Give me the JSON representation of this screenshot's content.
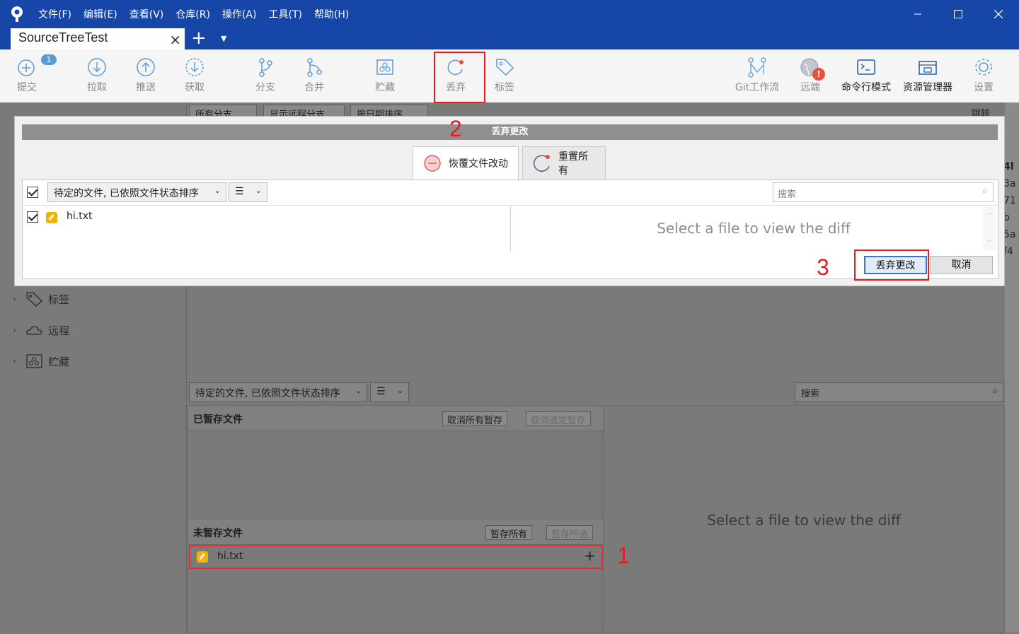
{
  "app": {
    "menu": [
      "文件(F)",
      "编辑(E)",
      "查看(V)",
      "仓库(R)",
      "操作(A)",
      "工具(T)",
      "帮助(H)"
    ],
    "tab_title": "SourceTreeTest"
  },
  "toolbar": {
    "commit": "提交",
    "commit_badge": "1",
    "pull": "拉取",
    "push": "推送",
    "fetch": "获取",
    "branch": "分支",
    "merge": "合并",
    "stash": "贮藏",
    "discard": "丢弃",
    "tag": "标签",
    "gitflow": "Git工作流",
    "remote": "远端",
    "terminal": "命令行模式",
    "explorer": "资源管理器",
    "settings": "设置"
  },
  "background": {
    "branch_filter": "所有分支",
    "show_remote": "显示远程分支",
    "sort_by": "按日期排序",
    "jump_to": "跳转到：",
    "right_edge_chars": [
      "4l",
      "3a",
      "71",
      "b",
      "5a",
      "f4"
    ],
    "sidebar": {
      "tags": "标签",
      "remotes": "远程",
      "stashes": "贮藏"
    },
    "file_sort": "待定的文件, 已依照文件状态排序",
    "search_placeholder": "搜索",
    "staged_title": "已暂存文件",
    "unstage_all": "取消所有暂存",
    "unstage_selected": "取消选定暂存",
    "unstaged_title": "未暂存文件",
    "stage_all": "暂存所有",
    "stage_selected": "暂存所选",
    "unstaged_file": "hi.txt",
    "diff_message": "Select a file to view the diff"
  },
  "dialog": {
    "title": "丢弃更改",
    "tab_revert": "恢覆文件改动",
    "tab_reset": "重置所有",
    "file_sort": "待定的文件, 已依照文件状态排序",
    "search_placeholder": "搜索",
    "file": "hi.txt",
    "diff_message": "Select a file to view the diff",
    "discard_button": "丢弃更改",
    "cancel_button": "取消"
  },
  "annotations": {
    "step1": "1",
    "step2": "2",
    "step3": "3",
    "color": "#e02020"
  },
  "colors": {
    "titlebar": "#1646a8",
    "accent": "#3a77c8",
    "file_modified": "#f0b400"
  }
}
